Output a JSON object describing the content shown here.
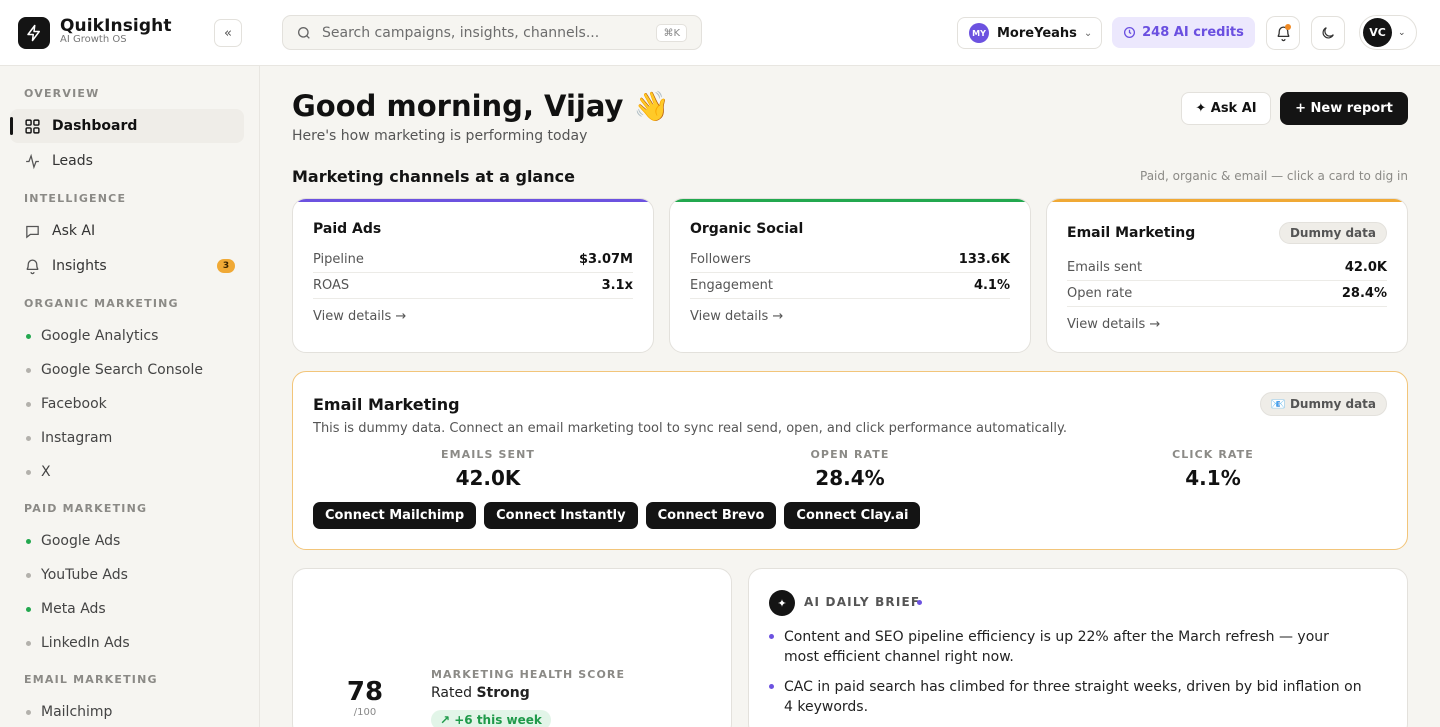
{
  "app": {
    "name": "QuikInsight",
    "tagline": "AI Growth OS",
    "collapse_label": "«"
  },
  "search": {
    "placeholder": "Search campaigns, insights, channels...",
    "shortcut": "⌘K",
    "icon": "search-icon"
  },
  "workspace": {
    "initials": "MY",
    "name": "MoreYeahs",
    "color": "#6c52e0"
  },
  "credits": {
    "label": "248 AI credits",
    "color": "#6a4fe0"
  },
  "user": {
    "initials": "VC"
  },
  "sidebar": {
    "sections": [
      {
        "label": "OVERVIEW"
      },
      {
        "label": "INTELLIGENCE"
      },
      {
        "label": "ORGANIC MARKETING"
      },
      {
        "label": "PAID MARKETING"
      },
      {
        "label": "EMAIL MARKETING"
      }
    ],
    "nav": [
      {
        "label": "Dashboard",
        "icon": "grid-icon",
        "active": true
      },
      {
        "label": "Leads",
        "icon": "activity-icon"
      },
      {
        "label": "Ask AI",
        "icon": "chat-icon"
      },
      {
        "label": "Insights",
        "icon": "bell-icon",
        "badge": "3"
      }
    ],
    "organic": [
      {
        "label": "Google Analytics",
        "connected": true
      },
      {
        "label": "Google Search Console",
        "connected": false
      },
      {
        "label": "Facebook",
        "connected": false
      },
      {
        "label": "Instagram",
        "connected": false
      },
      {
        "label": "X",
        "connected": false
      }
    ],
    "paid": [
      {
        "label": "Google Ads",
        "connected": true
      },
      {
        "label": "YouTube Ads",
        "connected": false
      },
      {
        "label": "Meta Ads",
        "connected": true
      },
      {
        "label": "LinkedIn Ads",
        "connected": false
      }
    ],
    "email": [
      {
        "label": "Mailchimp",
        "connected": false
      }
    ]
  },
  "header": {
    "greeting": "Good morning, Vijay 👋",
    "subtitle": "Here's how marketing is performing today",
    "ask_ai_label": "✦ Ask AI",
    "new_report_label": "+ New report"
  },
  "channels": {
    "title": "Marketing channels at a glance",
    "hint": "Paid, organic & email — click a card to dig in",
    "cards": [
      {
        "title": "Paid Ads",
        "accent": "#6c52e0",
        "rows": [
          {
            "k": "Pipeline",
            "v": "$3.07M"
          },
          {
            "k": "ROAS",
            "v": "3.1x"
          }
        ],
        "link": "View details →"
      },
      {
        "title": "Organic Social",
        "accent": "#23a84f",
        "rows": [
          {
            "k": "Followers",
            "v": "133.6K"
          },
          {
            "k": "Engagement",
            "v": "4.1%"
          }
        ],
        "link": "View details →"
      },
      {
        "title": "Email Marketing",
        "accent": "#f0a935",
        "pill": "Dummy data",
        "rows": [
          {
            "k": "Emails sent",
            "v": "42.0K"
          },
          {
            "k": "Open rate",
            "v": "28.4%"
          }
        ],
        "link": "View details →"
      }
    ]
  },
  "email_panel": {
    "title": "Email Marketing",
    "description": "This is dummy data. Connect an email marketing tool to sync real send, open, and click performance automatically.",
    "pill": "📧 Dummy data",
    "metrics": [
      {
        "label": "EMAILS SENT",
        "value": "42.0K"
      },
      {
        "label": "OPEN RATE",
        "value": "28.4%"
      },
      {
        "label": "CLICK RATE",
        "value": "4.1%"
      }
    ],
    "connect_buttons": [
      "Connect Mailchimp",
      "Connect Instantly",
      "Connect Brevo",
      "Connect Clay.ai"
    ],
    "border_color": "#f2c57a"
  },
  "health": {
    "score": "78",
    "max": "/100",
    "label": "MARKETING HEALTH SCORE",
    "rated_prefix": "Rated ",
    "rating": "Strong",
    "trend": "↗ +6 this week"
  },
  "brief": {
    "title": "AI DAILY BRIEF",
    "items": [
      "Content and SEO pipeline efficiency is up 22% after the March refresh — your most efficient channel right now.",
      "CAC in paid search has climbed for three straight weeks, driven by bid inflation on 4 keywords."
    ]
  }
}
